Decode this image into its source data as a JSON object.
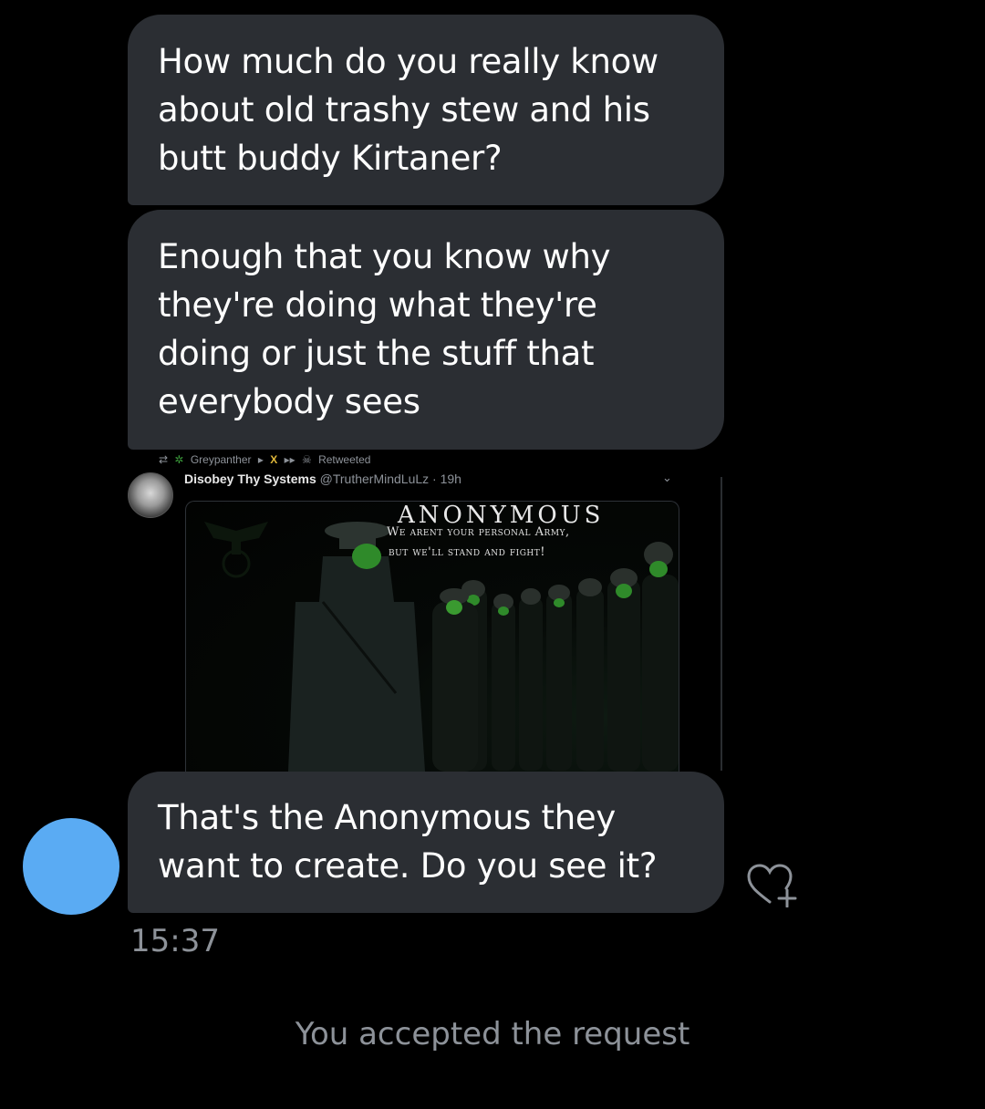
{
  "messages": [
    {
      "lines": [
        "How much do you really know",
        "about old trashy stew and his",
        "butt buddy Kirtaner?"
      ]
    },
    {
      "lines": [
        "Enough that you know why",
        "they're doing what they're",
        "doing or just the stuff that",
        "everybody sees"
      ]
    },
    {
      "lines": [
        "That's the Anonymous they",
        "want to create. Do you see it?"
      ]
    }
  ],
  "tweet": {
    "retweeter": "Greypanther",
    "retweet_marks": "X",
    "retweeted_label": "Retweeted",
    "author_name": "Disobey Thy Systems",
    "author_handle": "@TrutherMindLuLz",
    "time": "· 19h",
    "image_title": "ANONYMOUS",
    "image_subtitle_1": "We arent your personal Army,",
    "image_subtitle_2": "but we'll stand and fight!"
  },
  "timestamp": "15:37",
  "request_status": "You accepted the request",
  "colors": {
    "background": "#000000",
    "bubble": "#2b2e33",
    "avatar": "#5aabf3",
    "muted_text": "#8d9299"
  },
  "icons": {
    "like": "heart-plus-icon",
    "retweet": "retweet-icon",
    "menu": "chevron-down-icon"
  }
}
